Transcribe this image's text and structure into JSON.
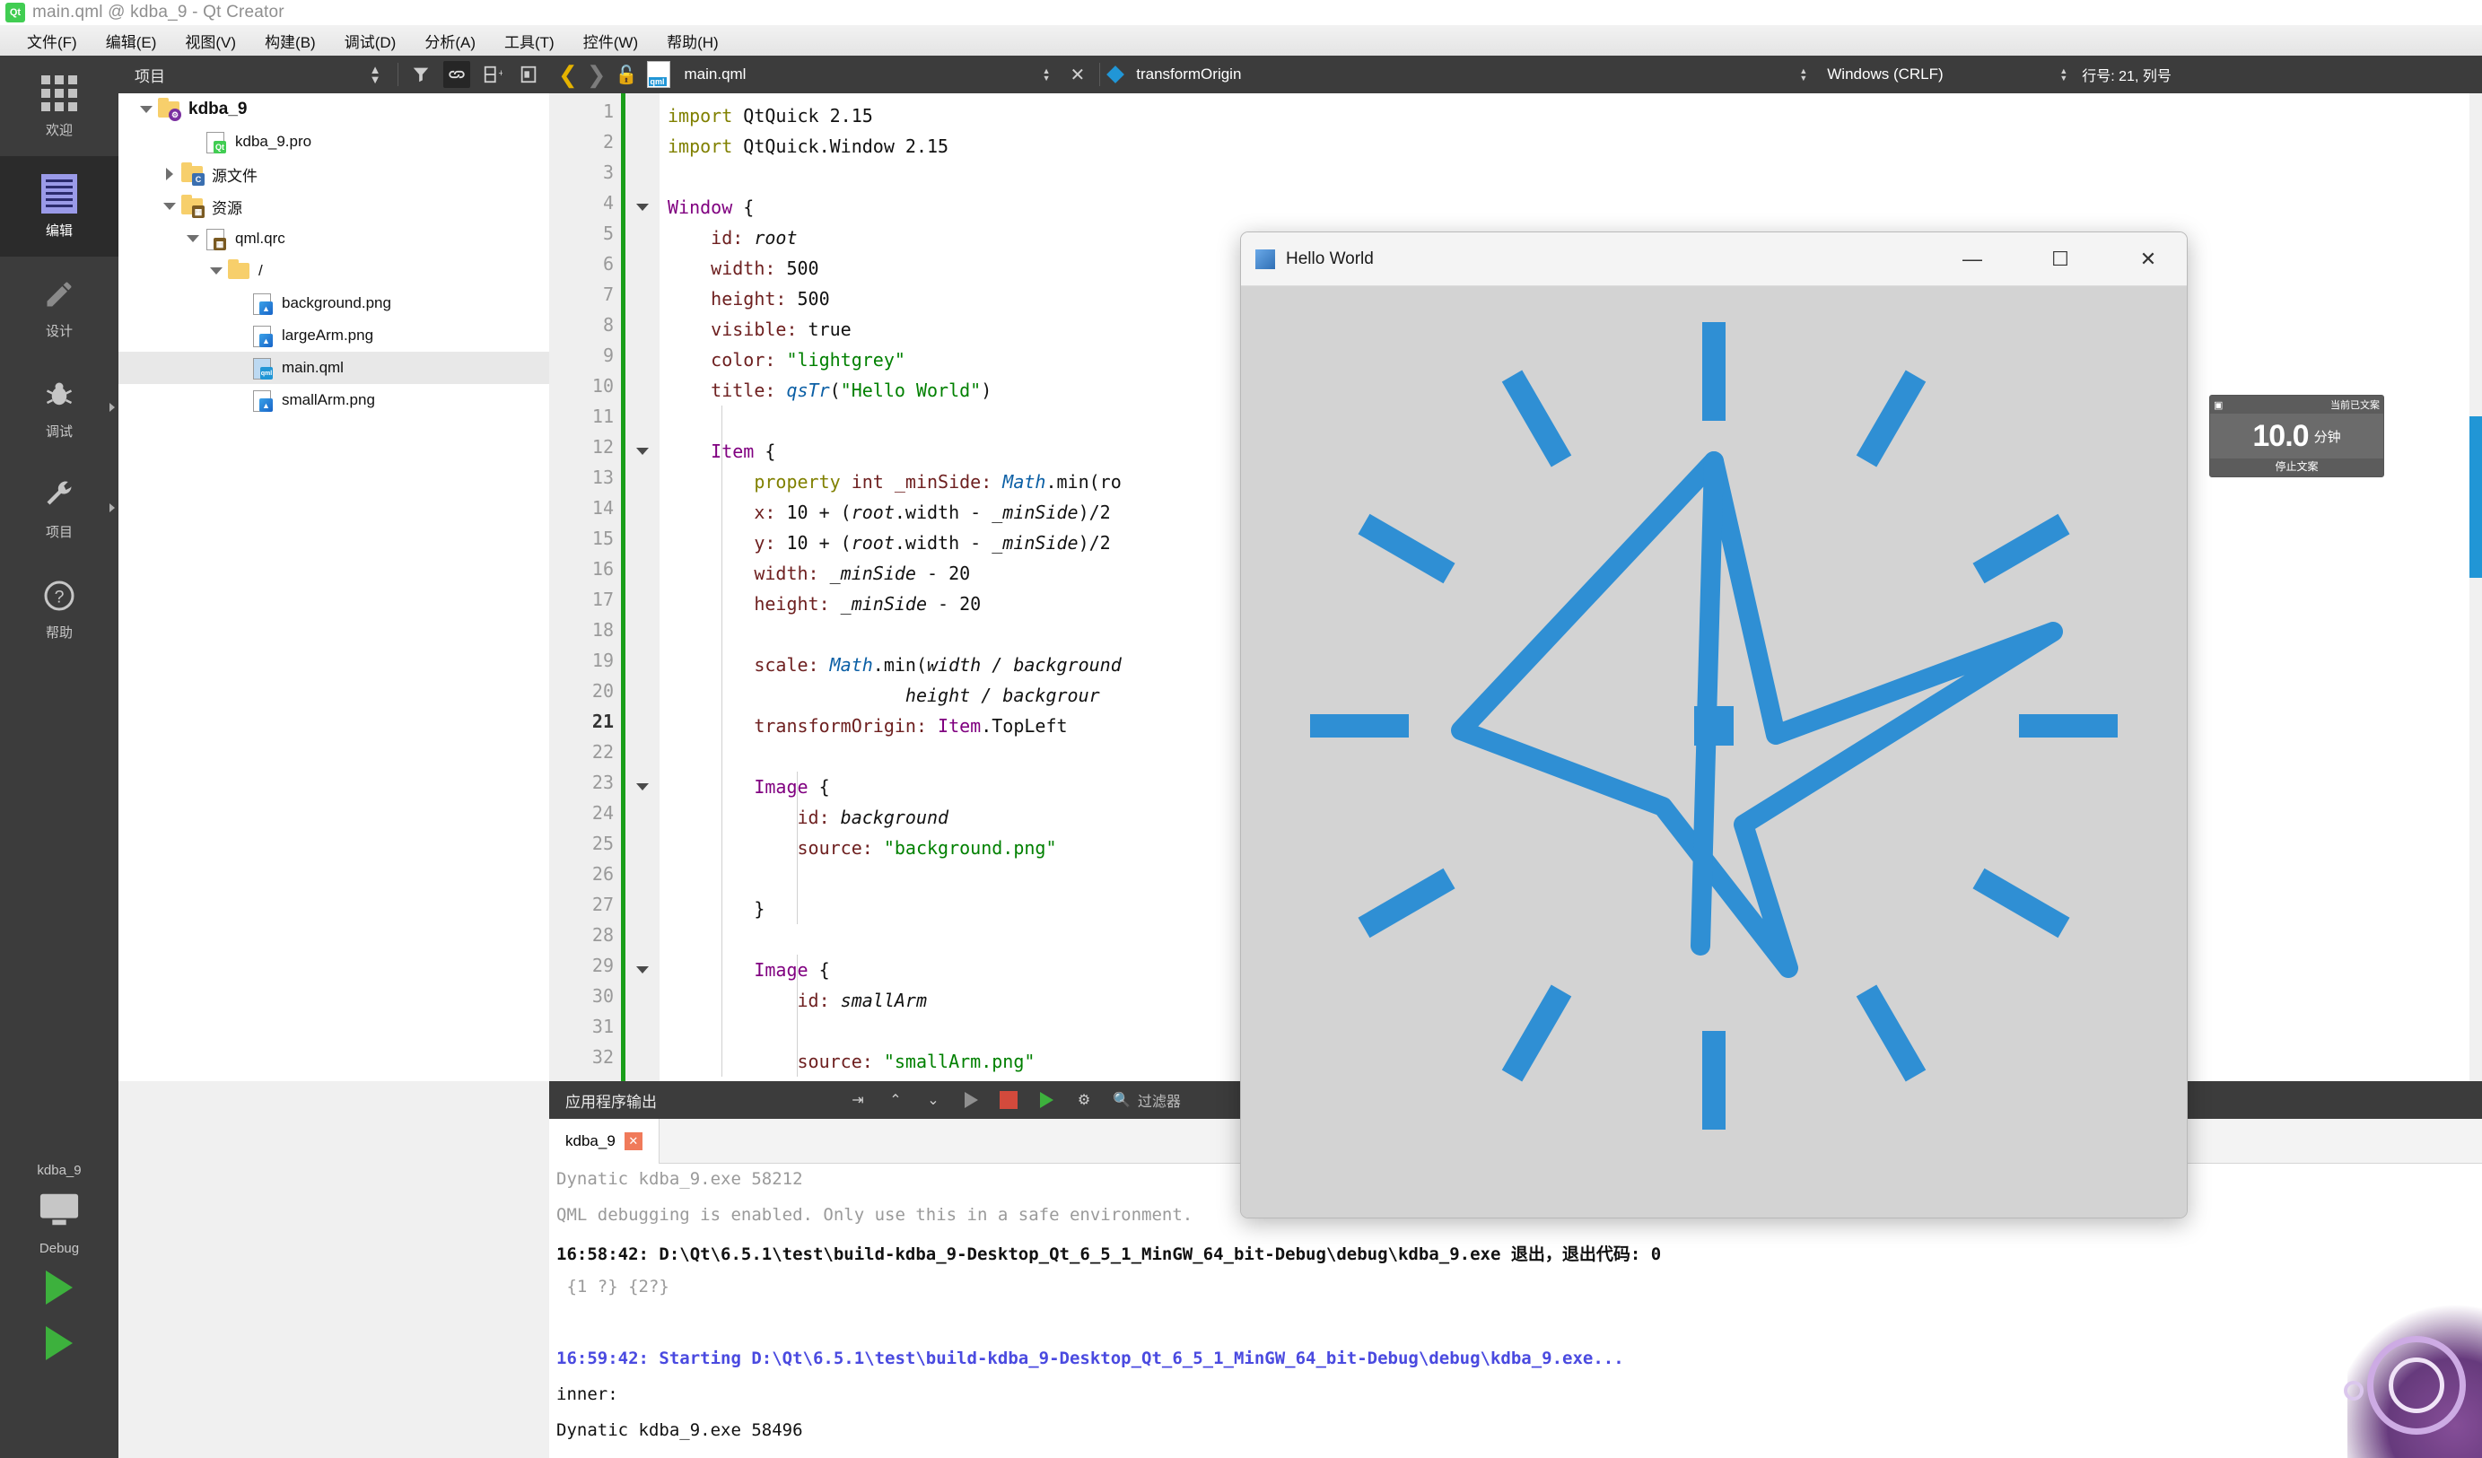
{
  "window": {
    "title": "main.qml @ kdba_9 - Qt Creator",
    "logo_text": "Qt"
  },
  "menubar": {
    "items": [
      {
        "label": "文件(F)"
      },
      {
        "label": "编辑(E)"
      },
      {
        "label": "视图(V)"
      },
      {
        "label": "构建(B)"
      },
      {
        "label": "调试(D)"
      },
      {
        "label": "分析(A)"
      },
      {
        "label": "工具(T)"
      },
      {
        "label": "控件(W)"
      },
      {
        "label": "帮助(H)"
      }
    ]
  },
  "activitybar": {
    "items": [
      {
        "label": "欢迎",
        "icon": "grid-icon",
        "selected": false
      },
      {
        "label": "编辑",
        "icon": "document-lines-icon",
        "selected": true
      },
      {
        "label": "设计",
        "icon": "pencil-icon",
        "selected": false
      },
      {
        "label": "调试",
        "icon": "bug-icon",
        "selected": false
      },
      {
        "label": "项目",
        "icon": "wrench-icon",
        "selected": false
      },
      {
        "label": "帮助",
        "icon": "question-icon",
        "selected": false
      }
    ],
    "kit": {
      "project_label": "kdba_9",
      "config_label": "Debug",
      "run_icon": "run-triangle-icon",
      "debug_icon": "debug-run-icon"
    }
  },
  "project_panel": {
    "header": "项目",
    "tools": [
      {
        "name": "sort-toggle-icon",
        "glyph": "⇕"
      },
      {
        "name": "filter-icon",
        "glyph": "▼"
      },
      {
        "name": "link-sync-icon",
        "glyph": "⛓",
        "active": true
      },
      {
        "name": "split-add-icon",
        "glyph": "⊞"
      },
      {
        "name": "collapse-panel-icon",
        "glyph": "◧"
      }
    ],
    "tree": [
      {
        "label": "kdba_9",
        "depth": 0,
        "expander": "down",
        "icon": "folder-project-icon",
        "bold": true,
        "selected": false
      },
      {
        "label": "kdba_9.pro",
        "depth": 2,
        "expander": "none",
        "icon": "file-qt-icon",
        "bold": false,
        "selected": false
      },
      {
        "label": "源文件",
        "depth": 1,
        "expander": "right",
        "icon": "folder-cpp-icon",
        "bold": false,
        "selected": false
      },
      {
        "label": "资源",
        "depth": 1,
        "expander": "down",
        "icon": "folder-resource-icon",
        "bold": false,
        "selected": false
      },
      {
        "label": "qml.qrc",
        "depth": 2,
        "expander": "down",
        "icon": "file-qrc-icon",
        "bold": false,
        "selected": false
      },
      {
        "label": "/",
        "depth": 3,
        "expander": "down",
        "icon": "folder-plain-icon",
        "bold": false,
        "selected": false
      },
      {
        "label": "background.png",
        "depth": 4,
        "expander": "none",
        "icon": "file-image-icon",
        "bold": false,
        "selected": false
      },
      {
        "label": "largeArm.png",
        "depth": 4,
        "expander": "none",
        "icon": "file-image-icon",
        "bold": false,
        "selected": false
      },
      {
        "label": "main.qml",
        "depth": 4,
        "expander": "none",
        "icon": "file-qml-icon",
        "bold": false,
        "selected": true
      },
      {
        "label": "smallArm.png",
        "depth": 4,
        "expander": "none",
        "icon": "file-image-icon",
        "bold": false,
        "selected": false
      }
    ]
  },
  "editor_toolbar": {
    "back_icon": "chevron-left-icon",
    "forward_icon": "chevron-right-icon",
    "lock_icon": "unlocked-icon",
    "file_icon": "qml-file-icon",
    "file_name": "main.qml",
    "close_icon": "✕",
    "symbol_icon": "diamond-icon",
    "symbol_name": "transformOrigin",
    "line_ending": "Windows (CRLF)",
    "cursor_pos": "行号: 21, 列号"
  },
  "code": {
    "lines": [
      {
        "n": 1,
        "fold": false,
        "tokens": [
          {
            "t": "import",
            "c": "k-kw"
          },
          {
            "t": " QtQuick 2.15",
            "c": "k-plain"
          }
        ]
      },
      {
        "n": 2,
        "fold": false,
        "tokens": [
          {
            "t": "import",
            "c": "k-kw"
          },
          {
            "t": " QtQuick.Window 2.15",
            "c": "k-plain"
          }
        ]
      },
      {
        "n": 3,
        "fold": false,
        "tokens": []
      },
      {
        "n": 4,
        "fold": true,
        "tokens": [
          {
            "t": "Window",
            "c": "k-type"
          },
          {
            "t": " {",
            "c": "k-plain"
          }
        ]
      },
      {
        "n": 5,
        "fold": false,
        "tokens": [
          {
            "t": "    id: ",
            "c": "k-prop"
          },
          {
            "t": "root",
            "c": "k-var"
          }
        ]
      },
      {
        "n": 6,
        "fold": false,
        "tokens": [
          {
            "t": "    width: ",
            "c": "k-prop"
          },
          {
            "t": "500",
            "c": "k-num"
          }
        ]
      },
      {
        "n": 7,
        "fold": false,
        "tokens": [
          {
            "t": "    height: ",
            "c": "k-prop"
          },
          {
            "t": "500",
            "c": "k-num"
          }
        ]
      },
      {
        "n": 8,
        "fold": false,
        "tokens": [
          {
            "t": "    visible: ",
            "c": "k-prop"
          },
          {
            "t": "true",
            "c": "k-num"
          }
        ]
      },
      {
        "n": 9,
        "fold": false,
        "tokens": [
          {
            "t": "    color: ",
            "c": "k-prop"
          },
          {
            "t": "\"lightgrey\"",
            "c": "k-str"
          }
        ]
      },
      {
        "n": 10,
        "fold": false,
        "tokens": [
          {
            "t": "    title: ",
            "c": "k-prop"
          },
          {
            "t": "qsTr",
            "c": "k-builtin"
          },
          {
            "t": "(",
            "c": "k-plain"
          },
          {
            "t": "\"Hello World\"",
            "c": "k-str"
          },
          {
            "t": ")",
            "c": "k-plain"
          }
        ]
      },
      {
        "n": 11,
        "fold": false,
        "tokens": []
      },
      {
        "n": 12,
        "fold": true,
        "tokens": [
          {
            "t": "    ",
            "c": "k-plain"
          },
          {
            "t": "Item",
            "c": "k-type"
          },
          {
            "t": " {",
            "c": "k-plain"
          }
        ]
      },
      {
        "n": 13,
        "fold": false,
        "tokens": [
          {
            "t": "        ",
            "c": "k-plain"
          },
          {
            "t": "property",
            "c": "k-kw"
          },
          {
            "t": " ",
            "c": "k-plain"
          },
          {
            "t": "int",
            "c": "k-prop"
          },
          {
            "t": " _minSide: ",
            "c": "k-prop"
          },
          {
            "t": "Math",
            "c": "k-builtin"
          },
          {
            "t": ".min(ro",
            "c": "k-plain"
          }
        ]
      },
      {
        "n": 14,
        "fold": false,
        "tokens": [
          {
            "t": "        x: ",
            "c": "k-prop"
          },
          {
            "t": "10",
            "c": "k-num"
          },
          {
            "t": " + (",
            "c": "k-plain"
          },
          {
            "t": "root",
            "c": "k-var"
          },
          {
            "t": ".width - ",
            "c": "k-plain"
          },
          {
            "t": "_minSide",
            "c": "k-var"
          },
          {
            "t": ")/2",
            "c": "k-plain"
          }
        ]
      },
      {
        "n": 15,
        "fold": false,
        "tokens": [
          {
            "t": "        y: ",
            "c": "k-prop"
          },
          {
            "t": "10",
            "c": "k-num"
          },
          {
            "t": " + (",
            "c": "k-plain"
          },
          {
            "t": "root",
            "c": "k-var"
          },
          {
            "t": ".width - ",
            "c": "k-plain"
          },
          {
            "t": "_minSide",
            "c": "k-var"
          },
          {
            "t": ")/2",
            "c": "k-plain"
          }
        ]
      },
      {
        "n": 16,
        "fold": false,
        "tokens": [
          {
            "t": "        width: ",
            "c": "k-prop"
          },
          {
            "t": "_minSide",
            "c": "k-var"
          },
          {
            "t": " - ",
            "c": "k-plain"
          },
          {
            "t": "20",
            "c": "k-num"
          }
        ]
      },
      {
        "n": 17,
        "fold": false,
        "tokens": [
          {
            "t": "        height: ",
            "c": "k-prop"
          },
          {
            "t": "_minSide",
            "c": "k-var"
          },
          {
            "t": " - ",
            "c": "k-plain"
          },
          {
            "t": "20",
            "c": "k-num"
          }
        ]
      },
      {
        "n": 18,
        "fold": false,
        "tokens": []
      },
      {
        "n": 19,
        "fold": false,
        "tokens": [
          {
            "t": "        scale: ",
            "c": "k-prop"
          },
          {
            "t": "Math",
            "c": "k-builtin"
          },
          {
            "t": ".min(",
            "c": "k-plain"
          },
          {
            "t": "width / background",
            "c": "k-var"
          }
        ]
      },
      {
        "n": 20,
        "fold": false,
        "tokens": [
          {
            "t": "                      ",
            "c": "k-plain"
          },
          {
            "t": "height / backgrour",
            "c": "k-var"
          }
        ]
      },
      {
        "n": 21,
        "fold": false,
        "tokens": [
          {
            "t": "        transformOrigin: ",
            "c": "k-prop"
          },
          {
            "t": "Item",
            "c": "k-type"
          },
          {
            "t": ".TopLeft",
            "c": "k-plain"
          }
        ],
        "current": true
      },
      {
        "n": 22,
        "fold": false,
        "tokens": []
      },
      {
        "n": 23,
        "fold": true,
        "tokens": [
          {
            "t": "        ",
            "c": "k-plain"
          },
          {
            "t": "Image",
            "c": "k-type"
          },
          {
            "t": " {",
            "c": "k-plain"
          }
        ]
      },
      {
        "n": 24,
        "fold": false,
        "tokens": [
          {
            "t": "            id: ",
            "c": "k-prop"
          },
          {
            "t": "background",
            "c": "k-var"
          }
        ]
      },
      {
        "n": 25,
        "fold": false,
        "tokens": [
          {
            "t": "            source: ",
            "c": "k-prop"
          },
          {
            "t": "\"background.png\"",
            "c": "k-str"
          }
        ]
      },
      {
        "n": 26,
        "fold": false,
        "tokens": []
      },
      {
        "n": 27,
        "fold": false,
        "tokens": [
          {
            "t": "        }",
            "c": "k-plain"
          }
        ]
      },
      {
        "n": 28,
        "fold": false,
        "tokens": []
      },
      {
        "n": 29,
        "fold": true,
        "tokens": [
          {
            "t": "        ",
            "c": "k-plain"
          },
          {
            "t": "Image",
            "c": "k-type"
          },
          {
            "t": " {",
            "c": "k-plain"
          }
        ]
      },
      {
        "n": 30,
        "fold": false,
        "tokens": [
          {
            "t": "            id: ",
            "c": "k-prop"
          },
          {
            "t": "smallArm",
            "c": "k-var"
          }
        ]
      },
      {
        "n": 31,
        "fold": false,
        "tokens": []
      },
      {
        "n": 32,
        "fold": false,
        "tokens": [
          {
            "t": "            source: ",
            "c": "k-prop"
          },
          {
            "t": "\"smallArm.png\"",
            "c": "k-str"
          }
        ]
      }
    ]
  },
  "output_panel": {
    "title": "应用程序输出",
    "tools": [
      {
        "name": "word-wrap-icon",
        "glyph": "⇥"
      },
      {
        "name": "prev-item-icon",
        "glyph": "︿"
      },
      {
        "name": "next-item-icon",
        "glyph": "﹀"
      },
      {
        "name": "run-icon",
        "glyph": "▶"
      },
      {
        "name": "stop-icon",
        "glyph": "■"
      },
      {
        "name": "rerun-icon",
        "glyph": "▶"
      },
      {
        "name": "settings-gear-icon",
        "glyph": "⚙"
      }
    ],
    "filter_icon": "search-icon",
    "filter_placeholder": "过滤器",
    "tab_label": "kdba_9",
    "tab_close_icon": "✕",
    "lines": [
      {
        "text": "Dynatic kdba_9.exe 58212",
        "style": "o-grey"
      },
      {
        "text": "QML debugging is enabled. Only use this in a safe environment.",
        "style": "o-grey"
      },
      {
        "text": "16:58:42: D:\\Qt\\6.5.1\\test\\build-kdba_9-Desktop_Qt_6_5_1_MinGW_64_bit-Debug\\debug\\kdba_9.exe 退出，退出代码: 0",
        "style": "o-black"
      },
      {
        "text": " {1 ?} {2?}",
        "style": "o-grey"
      },
      {
        "text": "",
        "style": "o-plain"
      },
      {
        "text": "16:59:42: Starting D:\\Qt\\6.5.1\\test\\build-kdba_9-Desktop_Qt_6_5_1_MinGW_64_bit-Debug\\debug\\kdba_9.exe...",
        "style": "o-blue"
      },
      {
        "text": "inner:",
        "style": "o-plain"
      },
      {
        "text": "Dynatic kdba_9.exe 58496",
        "style": "o-plain"
      }
    ]
  },
  "app_window": {
    "title": "Hello World",
    "icon": "app-icon",
    "minimize_icon": "—",
    "maximize_icon": "☐",
    "close_icon": "✕",
    "canvas_color": "#d3d3d3",
    "accent_color": "#2f8fd4"
  },
  "timer_widget": {
    "header": "当前已文案",
    "value": "10.0",
    "unit": "分钟",
    "footer": "停止文案",
    "pin_icon": "pin-icon"
  }
}
